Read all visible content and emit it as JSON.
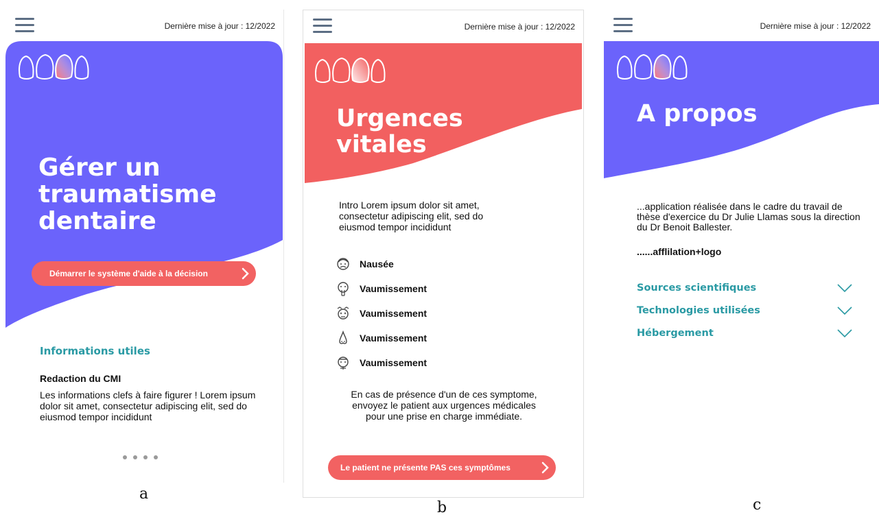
{
  "panels": {
    "a": {
      "update_text": "Dernière mise à jour : 12/2022",
      "title_lines": [
        "Gérer un",
        "traumatisme",
        "dentaire"
      ],
      "cta_label": "Démarrer le système d'aide à la décision",
      "section_title": "Informations utiles",
      "card_title": "Redaction du CMI",
      "card_text": "Les informations clefs à faire figurer ! Lorem ipsum dolor sit amet, consectetur adipiscing elit, sed do eiusmod tempor incididunt",
      "pagination_dots": 4,
      "caption": "a",
      "hero_color": "#6b63fb"
    },
    "b": {
      "update_text": "Dernière mise à jour : 12/2022",
      "title_lines": [
        "Urgences",
        "vitales"
      ],
      "intro": "Intro Lorem ipsum dolor sit amet, consectetur adipiscing elit, sed do eiusmod tempor incididunt",
      "symptoms": [
        {
          "label": "Nausée",
          "icon": "nausea-face-icon"
        },
        {
          "label": "Vaumissement",
          "icon": "vomit-face-icon"
        },
        {
          "label": "Vaumissement",
          "icon": "dizzy-face-icon"
        },
        {
          "label": "Vaumissement",
          "icon": "bleeding-nose-icon"
        },
        {
          "label": "Vaumissement",
          "icon": "sick-face-icon"
        }
      ],
      "advice": "En cas de présence d'un de ces symptome, envoyez le patient aux urgences médicales pour une prise en charge immédiate.",
      "cta_label": "Le patient ne présente PAS ces symptômes",
      "caption": "b",
      "hero_color": "#f26060"
    },
    "c": {
      "update_text": "Dernière mise à jour : 12/2022",
      "title": "A propos",
      "description": "...application réalisée dans le cadre du travail de thèse d'exercice du Dr Julie Llamas sous la direction du Dr Benoit Ballester.",
      "affiliation": "......afflilation+logo",
      "accordions": [
        "Sources scientifiques",
        "Technologies utilisées",
        "Hébergement"
      ],
      "caption": "c",
      "hero_color": "#6b63fb"
    }
  },
  "colors": {
    "accent_coral": "#f26262",
    "accent_teal": "#2a9aa4",
    "accent_violet": "#6b63fb",
    "icon_gray": "#5c6e84"
  }
}
